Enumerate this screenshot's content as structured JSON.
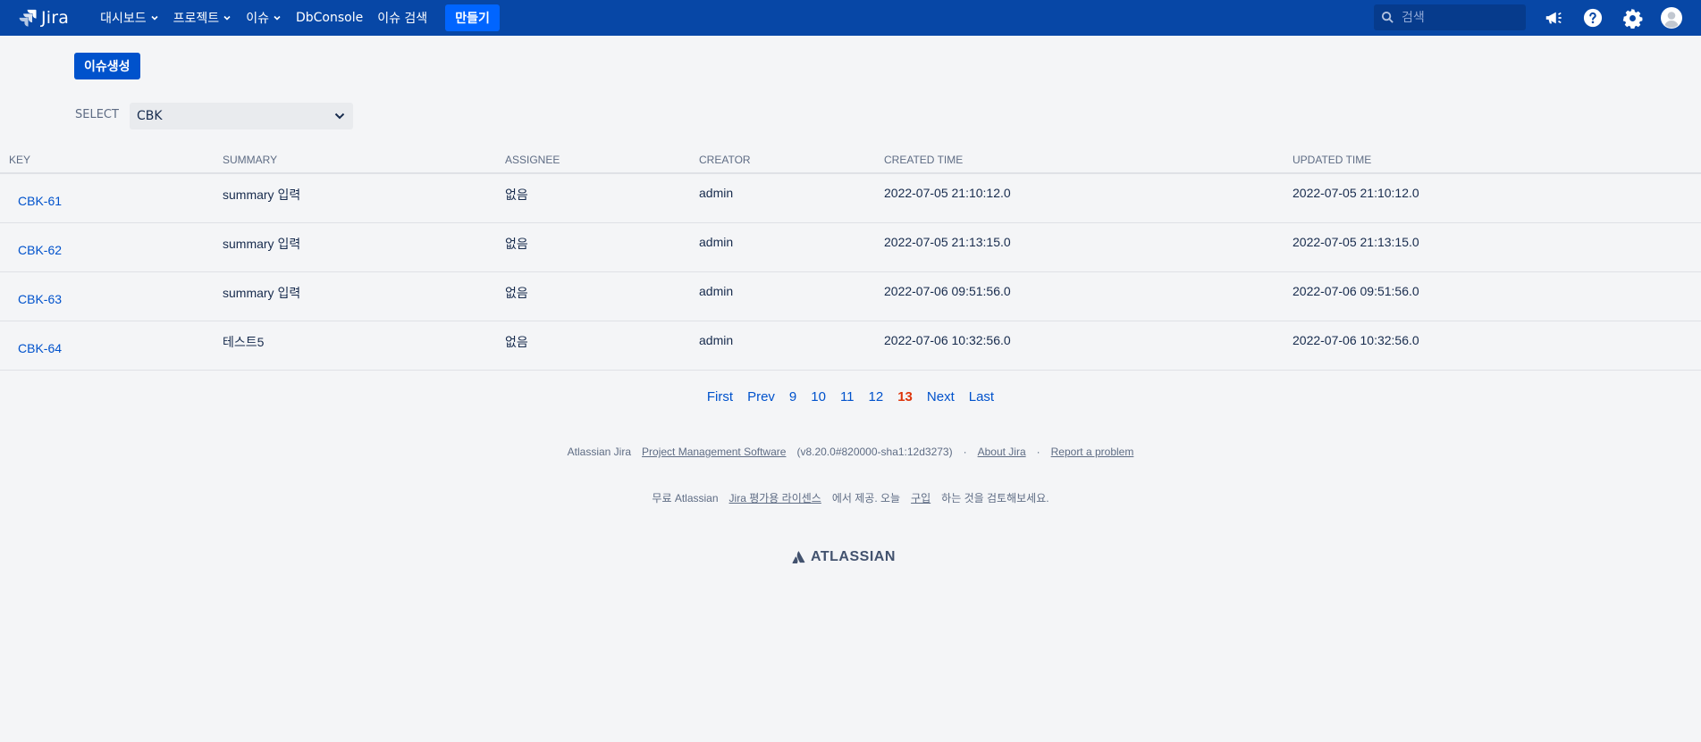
{
  "nav": {
    "logo_text": "Jira",
    "items": [
      {
        "label": "대시보드",
        "dropdown": true
      },
      {
        "label": "프로젝트",
        "dropdown": true
      },
      {
        "label": "이슈",
        "dropdown": true
      },
      {
        "label": "DbConsole",
        "dropdown": false
      },
      {
        "label": "이슈 검색",
        "dropdown": false
      }
    ],
    "create_label": "만들기",
    "search_placeholder": "검색",
    "icons": [
      "notifications-megaphone-icon",
      "help-icon",
      "settings-gear-icon",
      "user-avatar-icon"
    ],
    "bg_color": "#0747a6"
  },
  "page": {
    "issue_create_label": "이슈생성",
    "select_label": "SELECT",
    "select_value": "CBK"
  },
  "table": {
    "headers": [
      "KEY",
      "SUMMARY",
      "ASSIGNEE",
      "CREATOR",
      "CREATED TIME",
      "UPDATED TIME"
    ],
    "rows": [
      {
        "key": "CBK-61",
        "summary": "summary 입력",
        "assignee": "없음",
        "creator": "admin",
        "created": "2022-07-05 21:10:12.0",
        "updated": "2022-07-05 21:10:12.0"
      },
      {
        "key": "CBK-62",
        "summary": "summary 입력",
        "assignee": "없음",
        "creator": "admin",
        "created": "2022-07-05 21:13:15.0",
        "updated": "2022-07-05 21:13:15.0"
      },
      {
        "key": "CBK-63",
        "summary": "summary 입력",
        "assignee": "없음",
        "creator": "admin",
        "created": "2022-07-06 09:51:56.0",
        "updated": "2022-07-06 09:51:56.0"
      },
      {
        "key": "CBK-64",
        "summary": "테스트5",
        "assignee": "없음",
        "creator": "admin",
        "created": "2022-07-06 10:32:56.0",
        "updated": "2022-07-06 10:32:56.0"
      }
    ]
  },
  "pagination": {
    "first": "First",
    "prev": "Prev",
    "pages": [
      "9",
      "10",
      "11",
      "12",
      "13"
    ],
    "current": "13",
    "next": "Next",
    "last": "Last"
  },
  "footer": {
    "line1": {
      "product": "Atlassian Jira",
      "pm_link": "Project Management Software",
      "version": "(v8.20.0#820000-sha1:12d3273)",
      "sep": "·",
      "about": "About Jira",
      "report": "Report a problem"
    },
    "line2": {
      "prefix": "무료 Atlassian",
      "license_link": "Jira 평가용 라이센스",
      "middle": "에서 제공. 오늘",
      "buy_link": "구입",
      "suffix": "하는 것을 검토해보세요."
    },
    "brand": "ATLASSIAN"
  }
}
